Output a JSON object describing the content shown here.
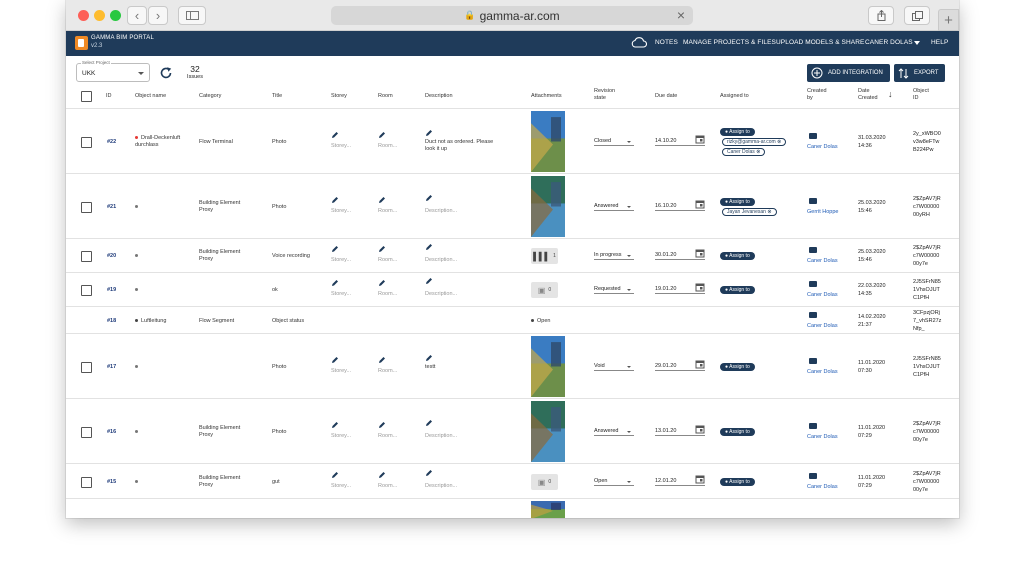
{
  "browser": {
    "url": "gamma-ar.com",
    "back_icon": "chevron-left-icon",
    "forward_icon": "chevron-right-icon",
    "sidebar_icon": "sidebar-icon",
    "share_icon": "share-icon",
    "tabs_icon": "tabs-icon",
    "newtab_label": "+"
  },
  "app": {
    "title": "GAMMA BIM PORTAL",
    "version": "v2.3",
    "nav": [
      "NOTES",
      "MANAGE PROJECTS & FILES",
      "UPLOAD MODELS & SHARE",
      "CANER DOLAS",
      "HELP"
    ],
    "colors": {
      "header": "#1f3b5a",
      "accent": "#1f3b5a",
      "logo": "#f08a24",
      "link": "#1f5bb5"
    }
  },
  "toolbar": {
    "project_label": "Select Project",
    "project_value": "UKK",
    "issue_count": "32",
    "issue_label": "Issues",
    "add_integration": "ADD INTEGRATION",
    "export": "EXPORT"
  },
  "table": {
    "headers": {
      "id": "ID",
      "object": "Object name",
      "category": "Category",
      "title": "Title",
      "storey": "Storey",
      "room": "Room",
      "description": "Description",
      "attachments": "Attachments",
      "revision1": "Revision",
      "revision2": "state",
      "due": "Due date",
      "assigned": "Assigned to",
      "created1": "Created",
      "created2": "by",
      "date1": "Date",
      "date2": "Created",
      "oid1": "Object",
      "oid2": "ID"
    },
    "placeholders": {
      "storey": "Storey...",
      "room": "Room...",
      "description": "Description..."
    },
    "assign_label": "Assign to",
    "rows": [
      {
        "id": "#22",
        "object": "Drall-Deckenluft durchlass",
        "object2": "",
        "category": "Flow Terminal",
        "category2": "",
        "title": "Photo",
        "description": "Duct not as ordered. Please look it up",
        "state": "Closed",
        "due": "14.10.20",
        "chips": [
          "rizky@gamma-ar.com",
          "Caner Dolas"
        ],
        "creator": "Caner Dolas",
        "date": "31.03.2020",
        "time": "14:36",
        "oid": [
          "2y_xWBO0",
          "v3w8eFTw",
          "B224Pw"
        ]
      },
      {
        "id": "#21",
        "object": "",
        "category": "Building Element",
        "category2": "Proxy",
        "title": "Photo",
        "description": "",
        "state": "Answered",
        "due": "16.10.20",
        "chips": [
          "Jayan Jevanesan"
        ],
        "creator": "Gerrit Hoppe",
        "date": "25.03.2020",
        "time": "15:46",
        "oid": [
          "2$ZpAV7jR",
          "c7W00000",
          "00yRH"
        ]
      },
      {
        "id": "#20",
        "object": "",
        "category": "Building Element",
        "category2": "Proxy",
        "title": "Voice recording",
        "description": "",
        "attachment_count": "1",
        "state": "In progress",
        "due": "30.01.20",
        "chips": [],
        "creator": "Caner Dolas",
        "date": "25.03.2020",
        "time": "15:46",
        "oid": [
          "2$ZpAV7jR",
          "c7W00000",
          "00y7e"
        ]
      },
      {
        "id": "#19",
        "object": "",
        "category": "",
        "category2": "",
        "title": "ok",
        "description": "",
        "attachment_count": "0",
        "state": "Requested",
        "due": "19.01.20",
        "chips": [],
        "creator": "Caner Dolas",
        "date": "22.03.2020",
        "time": "14:35",
        "oid": [
          "2J5SFrN85",
          "1VhsOJUT",
          "C1PfH"
        ]
      },
      {
        "id": "#18",
        "object": "Luftleitung",
        "category": "Flow Segment",
        "title": "Object status",
        "status": "Open",
        "creator": "Caner Dolas",
        "date": "14.02.2020",
        "time": "21:37",
        "oid": [
          "3CFpzjORj",
          "7_vhSR27z",
          "Nfp_"
        ]
      },
      {
        "id": "#17",
        "object": "",
        "category": "",
        "category2": "",
        "title": "Photo",
        "description": "testt",
        "state": "Void",
        "due": "29.01.20",
        "chips": [],
        "creator": "Caner Dolas",
        "date": "11.01.2020",
        "time": "07:30",
        "oid": [
          "2J5SFrN85",
          "1VhsOJUT",
          "C1PfH"
        ]
      },
      {
        "id": "#16",
        "object": "",
        "category": "Building Element",
        "category2": "Proxy",
        "title": "Photo",
        "description": "",
        "state": "Answered",
        "due": "13.01.20",
        "chips": [],
        "creator": "Caner Dolas",
        "date": "11.01.2020",
        "time": "07:29",
        "oid": [
          "2$ZpAV7jR",
          "c7W00000",
          "00y7e"
        ]
      },
      {
        "id": "#15",
        "object": "",
        "category": "Building Element",
        "category2": "Proxy",
        "title": "gut",
        "description": "",
        "attachment_count": "0",
        "state": "Open",
        "due": "12.01.20",
        "chips": [],
        "creator": "Caner Dolas",
        "date": "11.01.2020",
        "time": "07:29",
        "oid": [
          "2$ZpAV7jR",
          "c7W00000",
          "00y7e"
        ]
      }
    ]
  }
}
